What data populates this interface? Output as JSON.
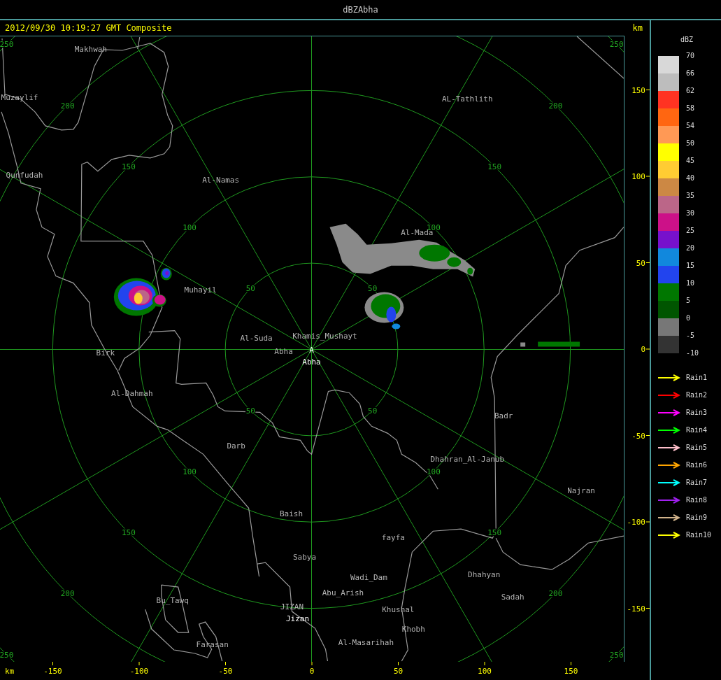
{
  "window": {
    "title": "dBZAbha"
  },
  "header": {
    "timestamp": "2012/09/30 10:19:27 GMT Composite",
    "unit": "km"
  },
  "map": {
    "rings": [
      {
        "labels": [
          "50",
          "50",
          "50",
          "50"
        ]
      },
      {
        "labels": [
          "100",
          "100",
          "100",
          "100"
        ]
      },
      {
        "labels": [
          "150",
          "150",
          "150",
          "150"
        ]
      },
      {
        "labels": [
          "200",
          "200",
          "200",
          "200"
        ]
      },
      {
        "labels": [
          "250",
          "250",
          "250",
          "250"
        ]
      }
    ],
    "places": [
      {
        "name": "Makhwah",
        "kind": "town"
      },
      {
        "name": "Muzaylif",
        "kind": "town"
      },
      {
        "name": "AL-Tathlith",
        "kind": "town"
      },
      {
        "name": "Qunfudah",
        "kind": "town"
      },
      {
        "name": "Al-Namas",
        "kind": "town"
      },
      {
        "name": "Al-Mada",
        "kind": "town"
      },
      {
        "name": "Muhayil",
        "kind": "town"
      },
      {
        "name": "Al-Suda",
        "kind": "town"
      },
      {
        "name": "Khamis_Mushayt",
        "kind": "town"
      },
      {
        "name": "Abha",
        "kind": "town"
      },
      {
        "name": "A",
        "kind": "site"
      },
      {
        "name": "Birk",
        "kind": "town"
      },
      {
        "name": "Abha",
        "kind": "site"
      },
      {
        "name": "Al-Dahmah",
        "kind": "town"
      },
      {
        "name": "Badr",
        "kind": "town"
      },
      {
        "name": "Darb",
        "kind": "town"
      },
      {
        "name": "Dhahran_Al-Janub",
        "kind": "town"
      },
      {
        "name": "Najran",
        "kind": "town"
      },
      {
        "name": "Baish",
        "kind": "town"
      },
      {
        "name": "fayfa",
        "kind": "town"
      },
      {
        "name": "Sabya",
        "kind": "town"
      },
      {
        "name": "Dhahyan",
        "kind": "town"
      },
      {
        "name": "Wadi_Dam",
        "kind": "town"
      },
      {
        "name": "Abu_Arish",
        "kind": "town"
      },
      {
        "name": "Sadah",
        "kind": "town"
      },
      {
        "name": "Bu_Tawq",
        "kind": "town"
      },
      {
        "name": "JIZAN",
        "kind": "town"
      },
      {
        "name": "Khushal",
        "kind": "town"
      },
      {
        "name": "Jizan",
        "kind": "site"
      },
      {
        "name": "Khobh",
        "kind": "town"
      },
      {
        "name": "Al-Masarihah",
        "kind": "town"
      },
      {
        "name": "Farasan",
        "kind": "town"
      }
    ]
  },
  "y_axis": {
    "ticks": [
      "150",
      "100",
      "50",
      "0",
      "-50",
      "-100",
      "-150"
    ]
  },
  "x_axis": {
    "unit": "km",
    "ticks": [
      "-150",
      "-100",
      "-50",
      "0",
      "50",
      "100",
      "150"
    ]
  },
  "legend": {
    "title": "dBZ",
    "bands": [
      {
        "color": "#d8d8d8"
      },
      {
        "color": "#bdbdbd"
      },
      {
        "color": "#ff3322"
      },
      {
        "color": "#ff6611"
      },
      {
        "color": "#ff9955"
      },
      {
        "color": "#ffff00"
      },
      {
        "color": "#ffcc33"
      },
      {
        "color": "#cc8844"
      },
      {
        "color": "#bb6688"
      },
      {
        "color": "#cc1188"
      },
      {
        "color": "#7711cc"
      },
      {
        "color": "#1188dd"
      },
      {
        "color": "#2244ee"
      },
      {
        "color": "#007700"
      },
      {
        "color": "#005500"
      },
      {
        "color": "#777777"
      },
      {
        "color": "#333333"
      }
    ],
    "labels": [
      "70",
      "66",
      "62",
      "58",
      "54",
      "50",
      "45",
      "40",
      "35",
      "30",
      "25",
      "20",
      "15",
      "10",
      "5",
      "0",
      "-5",
      "-10"
    ],
    "tracks": [
      {
        "label": "Rain1",
        "color": "#ffff00"
      },
      {
        "label": "Rain2",
        "color": "#ff0000"
      },
      {
        "label": "Rain3",
        "color": "#ff00ff"
      },
      {
        "label": "Rain4",
        "color": "#00ff00"
      },
      {
        "label": "Rain5",
        "color": "#ffc0cb"
      },
      {
        "label": "Rain6",
        "color": "#ffa500"
      },
      {
        "label": "Rain7",
        "color": "#00ffff"
      },
      {
        "label": "Rain8",
        "color": "#a020f0"
      },
      {
        "label": "Rain9",
        "color": "#d2b48c"
      },
      {
        "label": "Rain10",
        "color": "#ffff01"
      }
    ]
  }
}
